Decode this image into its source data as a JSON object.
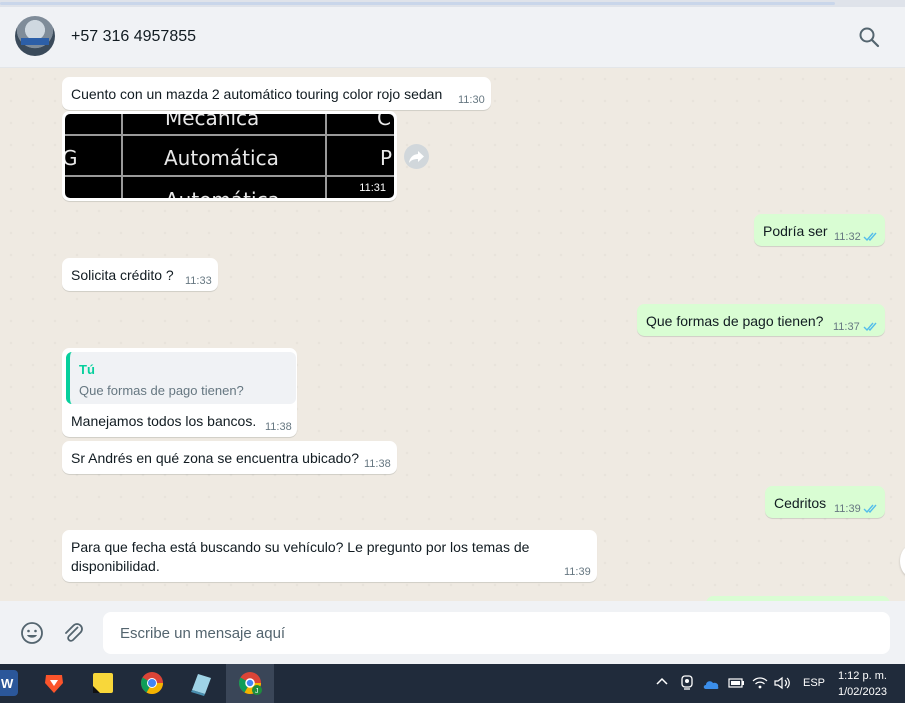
{
  "header": {
    "contact_name": "+57 316 4957855",
    "avatar": "contact-avatar",
    "search_icon": "search-icon"
  },
  "messages": [
    {
      "dir": "in",
      "text": "Cuento con un mazda 2 automático touring color rojo sedan",
      "time": "11:30"
    },
    {
      "dir": "in",
      "type": "image",
      "time": "11:31",
      "image_cells": [
        "Mecánica",
        "Automática",
        "Automática",
        "G",
        "P",
        "C"
      ]
    },
    {
      "dir": "out",
      "text": "Podría ser",
      "time": "11:32",
      "status": "read"
    },
    {
      "dir": "in",
      "text": "Solicita  crédito ?",
      "time": "11:33"
    },
    {
      "dir": "out",
      "text": "Que formas de pago tienen?",
      "time": "11:37",
      "status": "read"
    },
    {
      "dir": "in",
      "quote_author": "Tú",
      "quote_text": "Que formas de pago tienen?",
      "text": "Manejamos todos los bancos.",
      "time": "11:38"
    },
    {
      "dir": "in",
      "text": "Sr Andrés en qué zona se encuentra ubicado?",
      "time": "11:38"
    },
    {
      "dir": "out",
      "text": "Cedritos",
      "time": "11:39",
      "status": "read"
    },
    {
      "dir": "in",
      "text_line1": "Para que fecha está buscando su vehículo? Le pregunto por los temas de",
      "text_line2": "disponibilidad.",
      "time": "11:39"
    }
  ],
  "composer": {
    "placeholder": "Escribe un mensaje aquí",
    "emoji_icon": "emoji-icon",
    "attach_icon": "paperclip-icon"
  },
  "taskbar": {
    "apps": [
      "word-icon",
      "brave-icon",
      "sticky-notes-icon",
      "chrome-icon",
      "app-icon",
      "chrome-profile-icon"
    ],
    "language": "ESP",
    "time": "1:12 p. m.",
    "date": "1/02/2023"
  },
  "colors": {
    "incoming_bubble": "#ffffff",
    "outgoing_bubble": "#d9fdd3",
    "read_tick": "#53bdeb",
    "quote_accent": "#06cf9c",
    "chat_bg": "#efeae2",
    "taskbar_bg": "#202b3b"
  }
}
